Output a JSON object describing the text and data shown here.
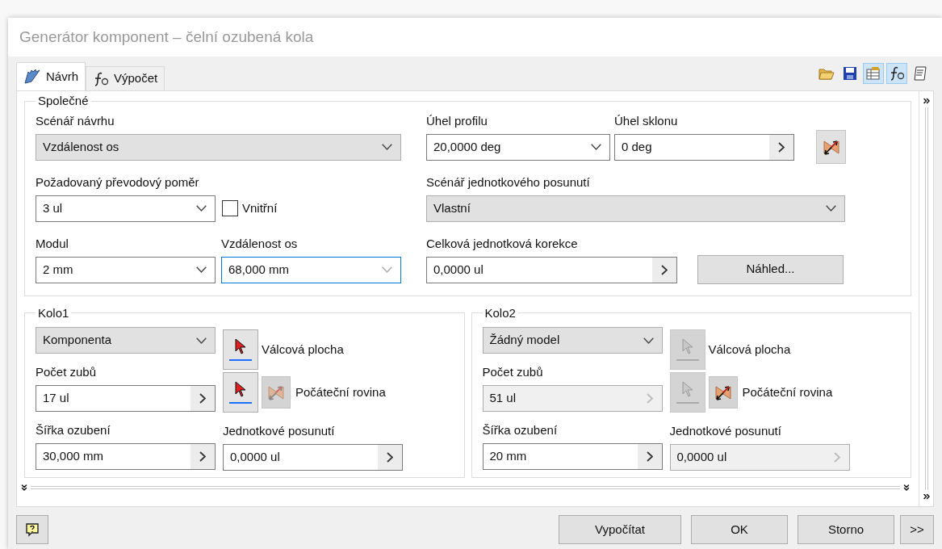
{
  "window": {
    "title": "Generátor komponent – čelní ozubená kola"
  },
  "tabs": [
    {
      "label": "Návrh",
      "kind": "gear",
      "selected": true
    },
    {
      "label": "Výpočet",
      "kind": "formula",
      "selected": false
    }
  ],
  "toolbar": [
    {
      "kind": "open",
      "pressed": false
    },
    {
      "kind": "save",
      "pressed": false
    },
    {
      "kind": "options",
      "pressed": true
    },
    {
      "kind": "formula",
      "pressed": true
    },
    {
      "kind": "notes",
      "pressed": false
    }
  ],
  "common": {
    "title": "Společné",
    "design_scenario": {
      "label": "Scénář návrhu",
      "value": "Vzdálenost os",
      "kind": "select"
    },
    "gear_ratio": {
      "label": "Požadovaný převodový poměr",
      "value": "3 ul",
      "kind": "combo"
    },
    "internal": {
      "label": "Vnitřní",
      "checked": false
    },
    "module": {
      "label": "Modul",
      "value": "2 mm",
      "kind": "combo"
    },
    "center_distance": {
      "label": "Vzdálenost os",
      "value": "68,000 mm",
      "kind": "combo",
      "focused": true
    },
    "pressure_angle": {
      "label": "Úhel profilu",
      "value": "20,0000 deg",
      "kind": "combo"
    },
    "helix_angle": {
      "label": "Úhel sklonu",
      "value": "0 deg",
      "kind": "spin"
    },
    "shift_scenario": {
      "label": "Scénář jednotkového posunutí",
      "value": "Vlastní",
      "kind": "select"
    },
    "total_correction": {
      "label": "Celková jednotková korekce",
      "value": "0,0000 ul",
      "kind": "spin"
    },
    "preview_button": "Náhled..."
  },
  "gears": [
    {
      "title": "Kolo1",
      "model": {
        "value": "Komponenta",
        "kind": "select"
      },
      "cylindrical_face": {
        "label": "Válcová plocha",
        "disabled": false
      },
      "teeth": {
        "label": "Počet zubů",
        "value": "17 ul",
        "kind": "spin",
        "disabled": false
      },
      "start_plane": {
        "label": "Počáteční rovina",
        "disabled": false
      },
      "face_width": {
        "label": "Šířka ozubení",
        "value": "30,000 mm",
        "kind": "spin",
        "disabled": false
      },
      "unit_shift": {
        "label": "Jednotkové posunutí",
        "value": "0,0000 ul",
        "kind": "spin",
        "disabled": false
      }
    },
    {
      "title": "Kolo2",
      "model": {
        "value": "Žádný model",
        "kind": "select"
      },
      "cylindrical_face": {
        "label": "Válcová plocha",
        "disabled": true
      },
      "teeth": {
        "label": "Počet zubů",
        "value": "51 ul",
        "kind": "spin",
        "disabled": true
      },
      "start_plane": {
        "label": "Počáteční rovina",
        "disabled": true
      },
      "face_width": {
        "label": "Šířka ozubení",
        "value": "20 mm",
        "kind": "spin",
        "disabled": false
      },
      "unit_shift": {
        "label": "Jednotkové posunutí",
        "value": "0,0000 ul",
        "kind": "spin",
        "disabled": true
      }
    }
  ],
  "buttons": [
    {
      "label": "Vypočítat"
    },
    {
      "label": "OK"
    },
    {
      "label": "Storno"
    },
    {
      "label": ">>"
    }
  ]
}
